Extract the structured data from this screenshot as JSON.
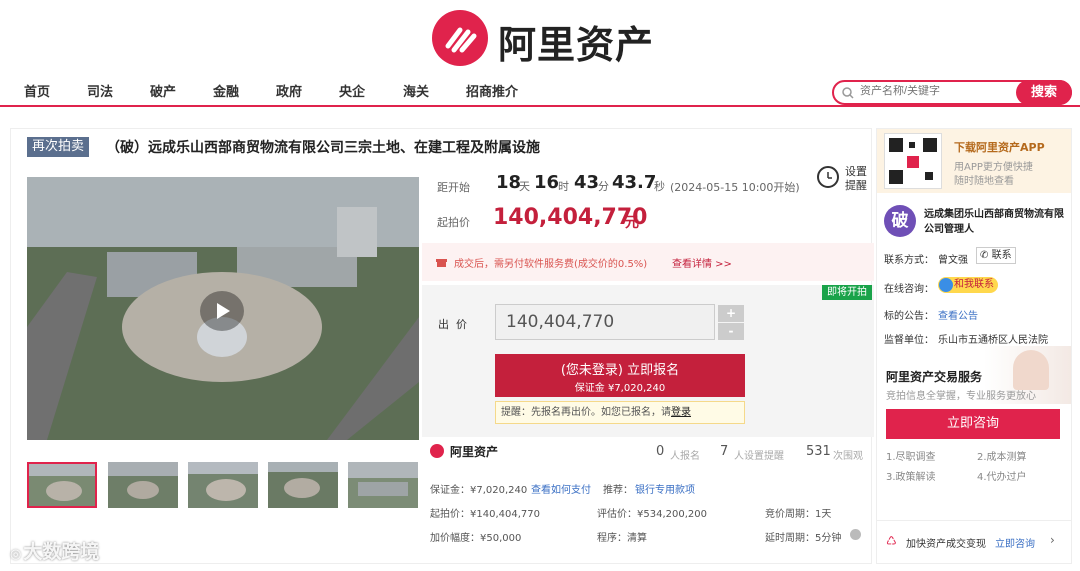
{
  "brand": {
    "name": "阿里资产"
  },
  "nav": [
    "首页",
    "司法",
    "破产",
    "金融",
    "政府",
    "央企",
    "海关",
    "招商推介"
  ],
  "search": {
    "placeholder": "资产名称/关键字",
    "button": "搜索"
  },
  "listing": {
    "badge": "再次拍卖",
    "title": "（破）远成乐山西部商贸物流有限公司三宗土地、在建工程及附属设施",
    "countdown": {
      "label": "距开始",
      "days": "18",
      "days_u": "天",
      "hours": "16",
      "hours_u": "时",
      "minutes": "43",
      "minutes_u": "分",
      "seconds": "43.7",
      "seconds_u": "秒",
      "start": "(2024-05-15 10:00开始)"
    },
    "reminder": "设置\n提醒",
    "start_price_label": "起拍价",
    "start_price": "140,404,770",
    "currency": "元",
    "fee_notice": "成交后，需另付软件服务费(成交价的0.5%)",
    "fee_link": "查看详情 >>",
    "status_tag": "即将开拍",
    "bid_label": "出  价",
    "bid_value": "140,404,770",
    "plus": "+",
    "minus": "-",
    "register_main": "(您未登录) 立即报名",
    "register_sub": "保证金 ¥7,020,240",
    "tip_text": "提醒：先报名再出价。如您已报名，请",
    "tip_link": "登录"
  },
  "stats": {
    "brand": "阿里资产",
    "signup": "0",
    "signup_l": "人报名",
    "remind": "7",
    "remind_l": "人设置提醒",
    "views": "531",
    "views_l": "次围观"
  },
  "details": {
    "deposit": "保证金：¥7,020,240",
    "deposit_link": "查看如何支付",
    "recommend": "推荐：",
    "recommend_link": "银行专用款项",
    "start_price": "起拍价：¥140,404,770",
    "appraisal": "评估价：¥534,200,200",
    "cycle": "竞价周期：1天",
    "increment": "加价幅度：¥50,000",
    "procedure": "程序：清算",
    "delay": "延时周期：5分钟"
  },
  "side": {
    "app_title": "下载阿里资产APP",
    "app_desc1": "用APP更方便快捷",
    "app_desc2": "随时随地查看",
    "org_icon": "破",
    "org_name": "远成集团乐山西部商贸物流有限公司管理人",
    "contact_label": "联系方式：",
    "contact_name": "曾文强",
    "contact_btn": "联系",
    "online_label": "在线咨询：",
    "online_btn": "和我联系",
    "notice_label": "标的公告：",
    "notice_link": "查看公告",
    "supervisor_label": "监督单位：",
    "supervisor": "乐山市五通桥区人民法院",
    "service_title": "阿里资产交易服务",
    "service_sub": "竞拍信息全掌握，专业服务更放心",
    "consult_btn": "立即咨询",
    "services": [
      "1.尽职调查",
      "2.成本测算",
      "3.政策解读",
      "4.代办过户"
    ],
    "footer_text": "加快资产成交变现",
    "footer_link": "立即咨询"
  },
  "watermark": "大数跨境"
}
